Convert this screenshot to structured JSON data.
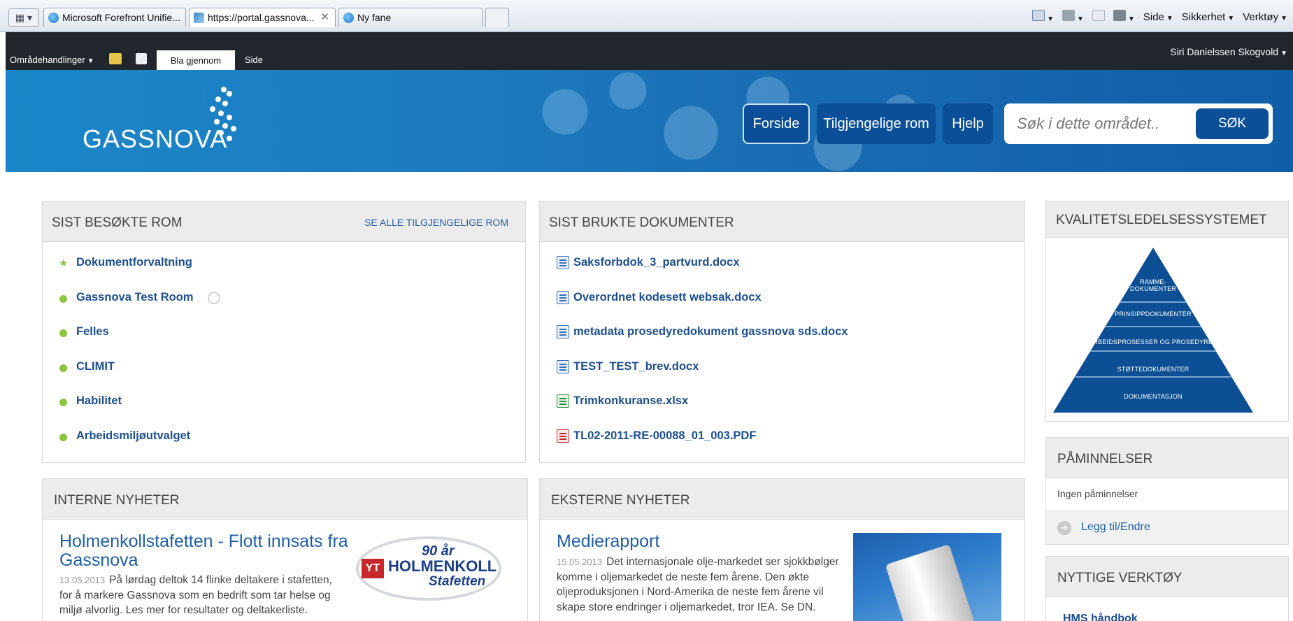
{
  "browser": {
    "tabs": [
      {
        "label": "Microsoft Forefront Unifie..."
      },
      {
        "label": "https://portal.gassnova..."
      },
      {
        "label": "Ny fane"
      }
    ],
    "commands": {
      "side": "Side",
      "sikkerhet": "Sikkerhet",
      "verktoy": "Verktøy"
    }
  },
  "ribbon": {
    "site_actions": "Områdehandlinger",
    "tab_browse": "Bla gjennom",
    "tab_page": "Side",
    "user": "Siri Danielssen Skogvold"
  },
  "header": {
    "logo": "GASSNOVA",
    "nav": [
      "Forside",
      "Tilgjengelige rom",
      "Hjelp"
    ],
    "search_placeholder": "Søk i dette området..",
    "search_button": "SØK"
  },
  "recent_rooms": {
    "title": "SIST BESØKTE ROM",
    "link": "SE ALLE TILGJENGELIGE ROM",
    "items": [
      "Dokumentforvaltning",
      "Gassnova Test Room",
      "Felles",
      "CLIMIT",
      "Habilitet",
      "Arbeidsmiljøutvalget"
    ]
  },
  "recent_docs": {
    "title": "SIST BRUKTE DOKUMENTER",
    "items": [
      "Saksforbdok_3_partvurd.docx",
      "Overordnet kodesett websak.docx",
      "metadata prosedyredokument gassnova sds.docx",
      "TEST_TEST_brev.docx",
      "Trimkonkuranse.xlsx",
      "TL02-2011-RE-00088_01_003.PDF"
    ]
  },
  "quality": {
    "title": "KVALITETSLEDELSESSYSTEMET",
    "levels": [
      "RAMME-",
      "DOKUMENTER",
      "PRINSIPPDOKUMENTER",
      "ARBEIDSPROSESSER OG PROSEDYRER",
      "STØTTEDOKUMENTER",
      "DOKUMENTASJON"
    ]
  },
  "reminders": {
    "title": "PÅMINNELSER",
    "empty": "Ingen påminnelser",
    "add": "Legg til/Endre"
  },
  "tools": {
    "title": "NYTTIGE VERKTØY",
    "first_link": "HMS håndbok"
  },
  "internal_news": {
    "title": "INTERNE NYHETER",
    "headline": "Holmenkollstafetten - Flott innsats fra Gassnova",
    "date": "13.05.2013",
    "body": "På lørdag deltok 14 flinke deltakere i stafetten, for å markere Gassnova som en bedrift som tar helse og miljø alvorlig. Les mer for resultater og deltakerliste.",
    "logo_top": "90 år",
    "logo_main": "HOLMENKOLL",
    "logo_sub": "Stafetten",
    "logo_yt": "YT"
  },
  "external_news": {
    "title": "EKSTERNE NYHETER",
    "headline": "Medierapport",
    "date": "15.05.2013",
    "body": "Det internasjonale olje-markedet ser sjokkbølger komme i oljemarkedet de neste fem årene. Den økte oljeproduksjonen i Nord-Amerika de neste fem årene vil skape store endringer i oljemarkedet, tror IEA. Se DN."
  },
  "colors": {
    "brand_blue": "#0a4f98",
    "link_blue": "#1d4f91",
    "bullet_green": "#8bc53f"
  }
}
